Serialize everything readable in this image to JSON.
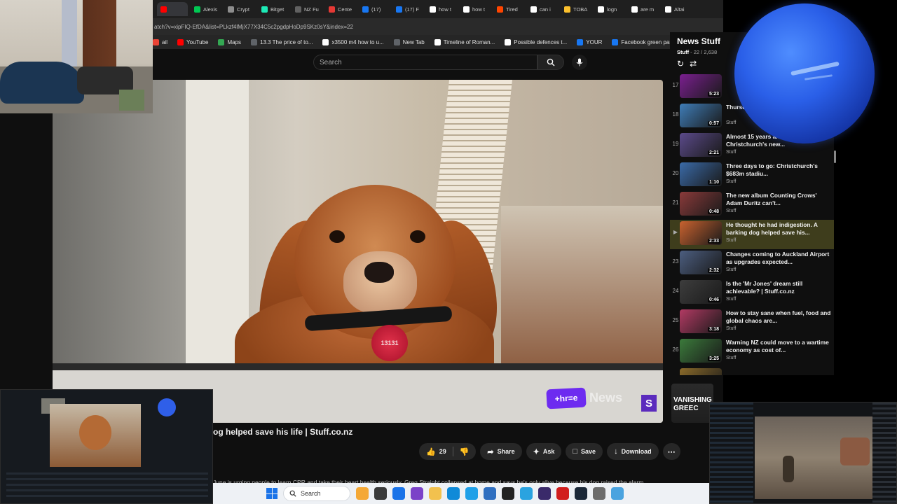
{
  "browser": {
    "tabs": [
      {
        "label": "",
        "color": "#ff0000",
        "active": true
      },
      {
        "label": "Alexis",
        "color": "#00c853"
      },
      {
        "label": "Crypt",
        "color": "#8e8e8e"
      },
      {
        "label": "Bitget",
        "color": "#1de9b6"
      },
      {
        "label": "NZ Fu",
        "color": "#616161"
      },
      {
        "label": "Cente",
        "color": "#e53935"
      },
      {
        "label": "(17)",
        "color": "#1877f2"
      },
      {
        "label": "(17) F",
        "color": "#1877f2"
      },
      {
        "label": "how t",
        "color": "#ffffff"
      },
      {
        "label": "how t",
        "color": "#ffffff"
      },
      {
        "label": "Tired",
        "color": "#ff4500"
      },
      {
        "label": "can i",
        "color": "#ffffff"
      },
      {
        "label": "TOBA",
        "color": "#fbc02d"
      },
      {
        "label": "logn",
        "color": "#ffffff"
      },
      {
        "label": "are m",
        "color": "#ffffff"
      },
      {
        "label": "Altai",
        "color": "#ffffff"
      }
    ],
    "url": "atch?v=xipFIQ-EfDA&list=PLkzf4lMjX77X34C5c2pgdpHoDp9SKz0sY&index=22",
    "bookmarks": [
      {
        "label": "ail",
        "color": "#ea4335"
      },
      {
        "label": "YouTube",
        "color": "#ff0000"
      },
      {
        "label": "Maps",
        "color": "#34a853"
      },
      {
        "label": "13.3 The price of to...",
        "color": "#5f6368"
      },
      {
        "label": "x3500 m4 how to u...",
        "color": "#ffffff"
      },
      {
        "label": "New Tab",
        "color": "#5f6368"
      },
      {
        "label": "Timeline of Roman...",
        "color": "#ffffff"
      },
      {
        "label": "Possible defences t...",
        "color": "#ffffff"
      },
      {
        "label": "YOUR",
        "color": "#1877f2"
      },
      {
        "label": "Facebook green party",
        "color": "#1877f2"
      }
    ]
  },
  "youtube": {
    "search_placeholder": "Search",
    "video_title": "og helped save his life | Stuff.co.nz",
    "like_count": "29",
    "share_label": "Share",
    "ask_label": "Ask",
    "save_label": "Save",
    "download_label": "Download",
    "description": "June is urging people to learn CPR and take their heart health seriously. Greg Straight collapsed at home and says he's only alive because his dog raised the alarm...",
    "overlay_brand": "+hr=e",
    "overlay_news": "News",
    "overlay_stuff": "S",
    "dog_tag_text": "13131",
    "rec_card_text": "VANISHING GREEC"
  },
  "playlist": {
    "title": "News Stuff",
    "channel": "Stuff",
    "position": "22 / 2,638",
    "items": [
      {
        "num": "17",
        "duration": "5:23",
        "title": "",
        "channel": "",
        "thumb": "#7a1f8f"
      },
      {
        "num": "18",
        "duration": "0:57",
        "title": "Thursday isn't looking great |...",
        "channel": "Stuff",
        "thumb": "#3f7db8"
      },
      {
        "num": "19",
        "duration": "2:21",
        "title": "Almost 15 years and $683m later: Christchurch's new...",
        "channel": "Stuff",
        "thumb": "#5b4a8a"
      },
      {
        "num": "20",
        "duration": "1:10",
        "title": "Three days to go: Christchurch's $683m stadiu...",
        "channel": "Stuff",
        "thumb": "#3a6aa8"
      },
      {
        "num": "21",
        "duration": "0:48",
        "title": "The new album Counting Crows' Adam Duritz can't...",
        "channel": "Stuff",
        "thumb": "#8a3a3a"
      },
      {
        "num": "▶",
        "duration": "2:33",
        "title": "He thought he had indigestion. A barking dog helped save his...",
        "channel": "Stuff",
        "thumb": "#c9622f",
        "active": true
      },
      {
        "num": "23",
        "duration": "2:32",
        "title": "Changes coming to Auckland Airport as upgrades expected...",
        "channel": "Stuff",
        "thumb": "#4c5e80"
      },
      {
        "num": "24",
        "duration": "0:46",
        "title": "Is the 'Mr Jones' dream still achievable? | Stuff.co.nz",
        "channel": "Stuff",
        "thumb": "#3d3d3d"
      },
      {
        "num": "25",
        "duration": "3:18",
        "title": "How to stay sane when fuel, food and global chaos are...",
        "channel": "Stuff",
        "thumb": "#b23a63"
      },
      {
        "num": "26",
        "duration": "3:25",
        "title": "Warning NZ could move to a wartime economy as cost of...",
        "channel": "Stuff",
        "thumb": "#3b7a3b"
      },
      {
        "num": "27",
        "duration": "",
        "title": "",
        "channel": "",
        "thumb": "#8a6a2a"
      }
    ]
  },
  "taskbar": {
    "search_label": "Search",
    "apps": [
      {
        "name": "widgets-icon",
        "color": "#f4a836"
      },
      {
        "name": "file-explorer-icon",
        "color": "#3a3a3a"
      },
      {
        "name": "chrome-icon",
        "color": "#1a73e8"
      },
      {
        "name": "store-icon",
        "color": "#7b42c8"
      },
      {
        "name": "folder-icon",
        "color": "#f2c14e"
      },
      {
        "name": "edge-icon",
        "color": "#0f8ad8"
      },
      {
        "name": "edge-beta-icon",
        "color": "#1fa0e8"
      },
      {
        "name": "calculator-icon",
        "color": "#2f6fc0"
      },
      {
        "name": "terminal-icon",
        "color": "#222222"
      },
      {
        "name": "telegram-icon",
        "color": "#2aa3e0"
      },
      {
        "name": "obs-icon",
        "color": "#3a2a6a"
      },
      {
        "name": "pdf-icon",
        "color": "#d11d1d"
      },
      {
        "name": "steam-icon",
        "color": "#1b2838"
      },
      {
        "name": "settings-icon",
        "color": "#6c6c6c"
      },
      {
        "name": "photos-icon",
        "color": "#4aa3df"
      }
    ]
  }
}
